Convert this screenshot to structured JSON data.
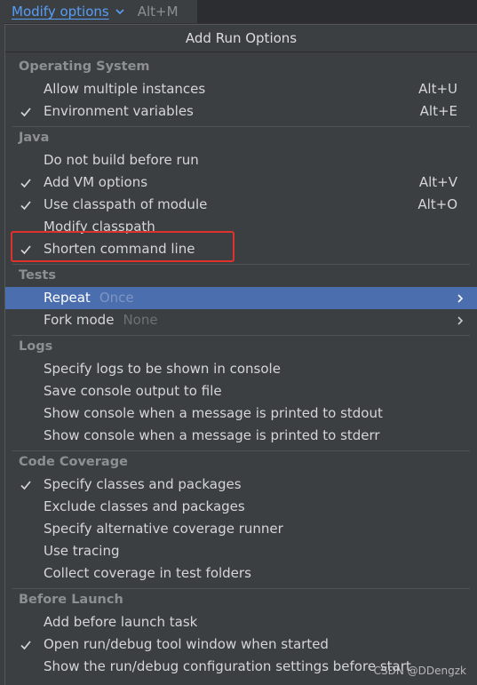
{
  "trigger": {
    "label": "Modify options",
    "shortcut": "Alt+M"
  },
  "popup": {
    "title": "Add Run Options"
  },
  "sections": {
    "os": {
      "title": "Operating System",
      "items": [
        {
          "label": "Allow multiple instances",
          "shortcut": "Alt+U",
          "checked": false
        },
        {
          "label": "Environment variables",
          "shortcut": "Alt+E",
          "checked": true
        }
      ]
    },
    "java": {
      "title": "Java",
      "items": [
        {
          "label": "Do not build before run",
          "shortcut": "",
          "checked": false
        },
        {
          "label": "Add VM options",
          "shortcut": "Alt+V",
          "checked": true
        },
        {
          "label": "Use classpath of module",
          "shortcut": "Alt+O",
          "checked": true
        },
        {
          "label": "Modify classpath",
          "shortcut": "",
          "checked": false
        },
        {
          "label": "Shorten command line",
          "shortcut": "",
          "checked": true
        }
      ]
    },
    "tests": {
      "title": "Tests",
      "items": [
        {
          "label": "Repeat",
          "hint": "Once",
          "submenu": true,
          "selected": true
        },
        {
          "label": "Fork mode",
          "hint": "None",
          "submenu": true,
          "selected": false
        }
      ]
    },
    "logs": {
      "title": "Logs",
      "items": [
        {
          "label": "Specify logs to be shown in console"
        },
        {
          "label": "Save console output to file"
        },
        {
          "label": "Show console when a message is printed to stdout"
        },
        {
          "label": "Show console when a message is printed to stderr"
        }
      ]
    },
    "coverage": {
      "title": "Code Coverage",
      "items": [
        {
          "label": "Specify classes and packages",
          "checked": true
        },
        {
          "label": "Exclude classes and packages",
          "checked": false
        },
        {
          "label": "Specify alternative coverage runner",
          "checked": false
        },
        {
          "label": "Use tracing",
          "checked": false
        },
        {
          "label": "Collect coverage in test folders",
          "checked": false
        }
      ]
    },
    "before_launch": {
      "title": "Before Launch",
      "items": [
        {
          "label": "Add before launch task",
          "checked": false
        },
        {
          "label": "Open run/debug tool window when started",
          "checked": true
        },
        {
          "label": "Show the run/debug configuration settings before start",
          "checked": false
        }
      ]
    }
  },
  "watermark": "CSDN @DDengzk",
  "colors": {
    "accent": "#589df6",
    "selection": "#4b6eaf",
    "annotation": "#e0322c"
  }
}
